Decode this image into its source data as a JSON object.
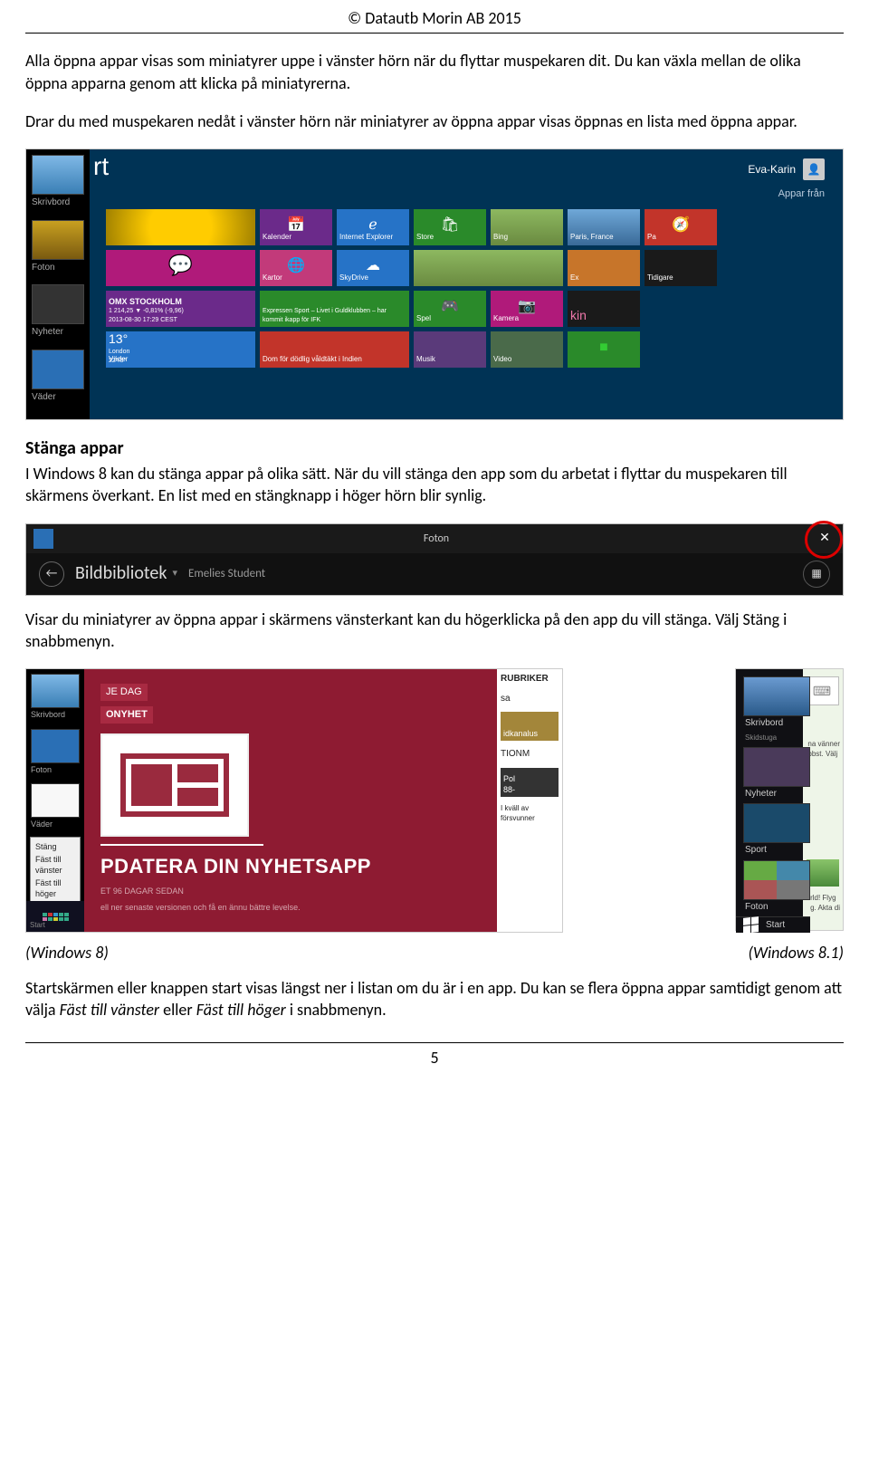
{
  "header": "© Datautb Morin AB 2015",
  "paragraphs": {
    "p1": "Alla öppna appar visas som miniatyrer uppe i vänster hörn när du flyttar muspekaren dit. Du kan växla mellan de olika öppna apparna genom att klicka på miniatyrerna.",
    "p2": "Drar du med muspekaren nedåt i vänster hörn när miniatyrer av öppna appar visas öppnas en lista med öppna appar.",
    "p3_title": "Stänga appar",
    "p3": "I Windows 8 kan du stänga appar på olika sätt. När du vill stänga den app som du arbetat i flyttar du muspekaren till skärmens överkant. En list med en stängknapp i höger hörn blir synlig.",
    "p4": "Visar du miniatyrer av öppna appar i skärmens vänsterkant kan du högerklicka på den app du vill stänga. Välj Stäng i snabbmenyn.",
    "p5": "Startskärmen eller knappen start visas längst ner i listan om du är i en app. Du kan se flera öppna appar samtidigt genom att välja Fäst till vänster eller Fäst till höger i snabbmenyn."
  },
  "captions": {
    "w8": "(Windows 8)",
    "w81": "(Windows 8.1)"
  },
  "page_number": "5",
  "fig1": {
    "rt": "rt",
    "user": "Eva-Karin",
    "apps_from": "Appar från",
    "sidebar": [
      "Skrivbord",
      "Foton",
      "Nyheter",
      "Väder"
    ],
    "tiles": {
      "kalender": "Kalender",
      "ie": "Internet Explorer",
      "store": "Store",
      "bing": "Bing",
      "paris": "Paris, France",
      "kartor": "Kartor",
      "skydrive": "SkyDrive",
      "stock_t": "OMX STOCKHOLM",
      "stock_s": "1 214,25 ▼ -0,81% (-9,96)\n2013-08-30 17:29 CEST",
      "sport": "Expressen Sport – Livet i Guldklubben – har kommit ikapp för IFK",
      "spel": "Spel",
      "kamera": "Kamera",
      "kin": "kin",
      "weather_t": "13°",
      "weather_s": "London\n22°/8°",
      "vader": "Väder",
      "news": "Dom för dödlig våldtäkt i Indien",
      "musik": "Musik",
      "video": "Video",
      "tidigare": "Tidigare",
      "pa": "Pa",
      "ex": "Ex"
    }
  },
  "fig2": {
    "title": "Foton",
    "lib": "Bildbibliotek",
    "sub": "Emelies Student"
  },
  "fig3": {
    "sidebar": [
      "Skrivbord",
      "Foton",
      "Väder"
    ],
    "ctx": [
      "Stäng",
      "Fäst till vänster",
      "Fäst till höger"
    ],
    "badge1": "JE DAG",
    "badge2": "ONYHET",
    "headline": "PDATERA DIN NYHETSAPP",
    "subline": "ET 96 DAGAR SEDAN",
    "small": "ell ner senaste versionen och få en ännu bättre levelse.",
    "rubriker": "RUBRIKER",
    "right1": "sa",
    "right2_t": "idkanalus",
    "right2_s": "TIONM",
    "right3a": "Pol",
    "right3b": "88-",
    "right4": "I kväll av\nförsvunner",
    "startlab": "Start"
  },
  "fig4": {
    "labels": [
      "Skrivbord",
      "Skidstuga",
      "Nyheter",
      "Sport",
      "Foton"
    ],
    "start": "Start",
    "rtext1": "na vänner\nbbst. Välj",
    "rtext2": "rld! Flyg\ng. Akta di"
  }
}
